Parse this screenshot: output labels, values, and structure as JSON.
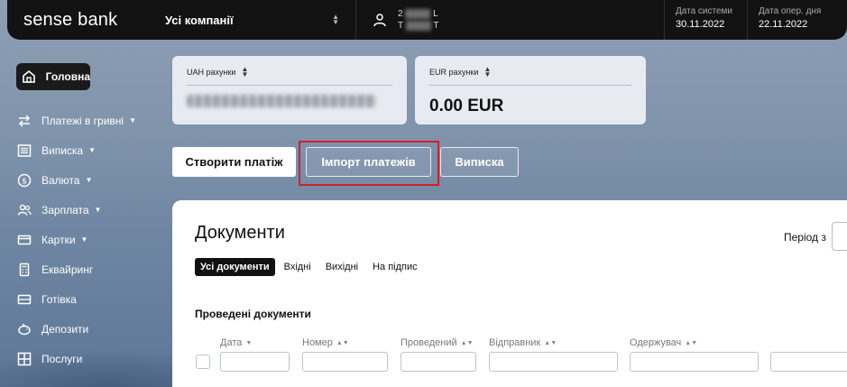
{
  "header": {
    "logo": "sense bank",
    "company": "Усі компанії",
    "user_line1": "2",
    "user_line1_end": "L",
    "user_line2": "T",
    "user_line2_end": "T",
    "system_date_label": "Дата системи",
    "system_date": "30.11.2022",
    "op_date_label": "Дата опер. дня",
    "op_date": "22.11.2022"
  },
  "sidebar": {
    "items": [
      {
        "label": "Головна",
        "icon": "home-icon"
      },
      {
        "label": "Платежі в гривні",
        "icon": "transfer-icon",
        "caret": "▼"
      },
      {
        "label": "Виписка",
        "icon": "statement-icon",
        "caret": "▼"
      },
      {
        "label": "Валюта",
        "icon": "dollar-icon",
        "caret": "▼"
      },
      {
        "label": "Зарплата",
        "icon": "users-icon",
        "caret": "▼"
      },
      {
        "label": "Картки",
        "icon": "card-icon",
        "caret": "▼"
      },
      {
        "label": "Еквайринг",
        "icon": "terminal-icon"
      },
      {
        "label": "Готівка",
        "icon": "cash-icon"
      },
      {
        "label": "Депозити",
        "icon": "piggy-icon"
      },
      {
        "label": "Послуги",
        "icon": "grid-icon"
      }
    ]
  },
  "accounts": {
    "uah_label": "UAH рахунки",
    "eur_label": "EUR рахунки",
    "eur_amount": "0.00 EUR"
  },
  "actions": {
    "create": "Створити платіж",
    "import": "Імпорт платежів",
    "statement": "Виписка"
  },
  "documents": {
    "title": "Документи",
    "period_label": "Період з",
    "tabs": [
      "Усі документи",
      "Вхідні",
      "Вихідні",
      "На підпис"
    ],
    "section": "Проведені документи",
    "columns": [
      "Дата",
      "Номер",
      "Проведений",
      "Відправник",
      "Одержувач"
    ]
  },
  "colors": {
    "topbar": "#121212",
    "accent_highlight": "#d0202a",
    "panel": "#ffffff"
  }
}
